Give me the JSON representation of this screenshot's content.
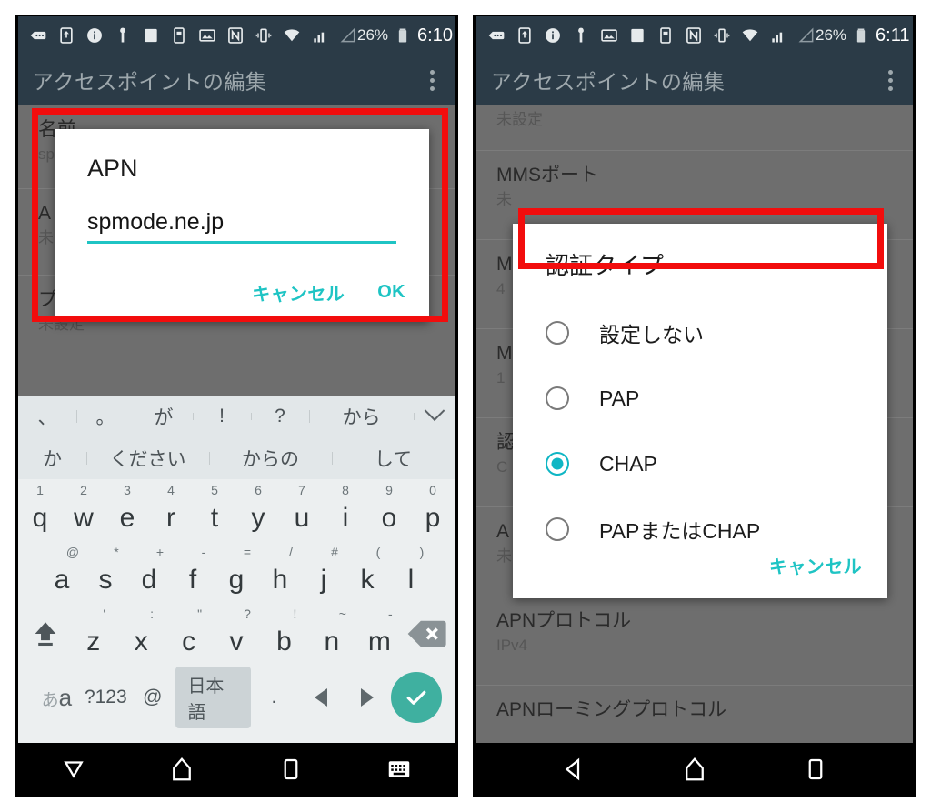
{
  "left_phone": {
    "status_bar": {
      "icons": [
        "sms-icon",
        "sd-card-icon",
        "info-icon",
        "usb-key-icon",
        "screenshot-icon",
        "image-icon",
        "sim-icon",
        "nfc-icon",
        "vibrate-icon",
        "wifi-icon",
        "signal-icon",
        "signal-alt-icon"
      ],
      "battery_percent": "26%",
      "battery_icon": "battery-icon",
      "clock": "6:10"
    },
    "app_bar": {
      "title": "アクセスポイントの編集",
      "overflow_icon": "more-vert-icon"
    },
    "list": [
      {
        "title": "名前",
        "subtitle": "sp"
      },
      {
        "title": "A",
        "subtitle": "未"
      },
      {
        "title": "プロキシ",
        "subtitle": "未設定"
      }
    ],
    "dialog": {
      "title": "APN",
      "input_value": "spmode.ne.jp",
      "cancel_label": "キャンセル",
      "ok_label": "OK",
      "accent_color": "#1fc4c4"
    },
    "keyboard": {
      "suggestions_row1": [
        "、",
        "。",
        "が",
        "!",
        "?",
        "から"
      ],
      "expand_icon": "chevron-down-icon",
      "suggestions_row2": [
        "か",
        "ください",
        "からの",
        "して"
      ],
      "row1": [
        {
          "main": "q",
          "sup": "1"
        },
        {
          "main": "w",
          "sup": "2"
        },
        {
          "main": "e",
          "sup": "3"
        },
        {
          "main": "r",
          "sup": "4"
        },
        {
          "main": "t",
          "sup": "5"
        },
        {
          "main": "y",
          "sup": "6"
        },
        {
          "main": "u",
          "sup": "7"
        },
        {
          "main": "i",
          "sup": "8"
        },
        {
          "main": "o",
          "sup": "9"
        },
        {
          "main": "p",
          "sup": "0"
        }
      ],
      "row2": [
        {
          "main": "a",
          "sup": "@"
        },
        {
          "main": "s",
          "sup": "*"
        },
        {
          "main": "d",
          "sup": "+"
        },
        {
          "main": "f",
          "sup": "-"
        },
        {
          "main": "g",
          "sup": "="
        },
        {
          "main": "h",
          "sup": "/"
        },
        {
          "main": "j",
          "sup": "#"
        },
        {
          "main": "k",
          "sup": "("
        },
        {
          "main": "l",
          "sup": ")"
        }
      ],
      "row3": [
        {
          "main": "z",
          "sup": "'"
        },
        {
          "main": "x",
          "sup": ":"
        },
        {
          "main": "c",
          "sup": "\""
        },
        {
          "main": "v",
          "sup": "?"
        },
        {
          "main": "b",
          "sup": "!"
        },
        {
          "main": "n",
          "sup": "~"
        },
        {
          "main": "m",
          "sup": "-"
        }
      ],
      "shift_icon": "shift-icon",
      "backspace_icon": "backspace-icon",
      "mode_label_kana": "あ",
      "mode_label_alpha": "a",
      "symbols_label": "?123",
      "at_label": "@",
      "language_label": "日本語",
      "period_label": ".",
      "arrow_left_icon": "arrow-left-icon",
      "arrow_right_icon": "arrow-right-icon",
      "enter_icon": "check-icon",
      "enter_color": "#3fb0a0"
    },
    "nav_bar": {
      "buttons": [
        "hide-keyboard-icon",
        "home-icon",
        "recents-icon",
        "keyboard-switch-icon"
      ]
    },
    "annotation": {
      "color": "#f20d0d",
      "target": "apn-dialog"
    }
  },
  "right_phone": {
    "status_bar": {
      "icons": [
        "sms-icon",
        "sd-card-icon",
        "info-icon",
        "usb-key-icon",
        "image-icon",
        "screenshot-icon",
        "sim-icon",
        "nfc-icon",
        "vibrate-icon",
        "wifi-icon",
        "signal-icon",
        "signal-alt-icon"
      ],
      "battery_percent": "26%",
      "battery_icon": "battery-icon",
      "clock": "6:11"
    },
    "app_bar": {
      "title": "アクセスポイントの編集",
      "overflow_icon": "more-vert-icon"
    },
    "list": [
      {
        "title": "",
        "subtitle": "未設定"
      },
      {
        "title": "MMSポート",
        "subtitle": "未"
      },
      {
        "title": "M",
        "subtitle": "4"
      },
      {
        "title": "M",
        "subtitle": "1"
      },
      {
        "title": "認",
        "subtitle": "C"
      },
      {
        "title": "A",
        "subtitle": "未設定"
      },
      {
        "title": "APNプロトコル",
        "subtitle": "IPv4"
      },
      {
        "title": "APNローミングプロトコル",
        "subtitle": ""
      }
    ],
    "dialog": {
      "title": "認証タイプ",
      "options": [
        {
          "label": "設定しない",
          "selected": false
        },
        {
          "label": "PAP",
          "selected": false
        },
        {
          "label": "CHAP",
          "selected": true
        },
        {
          "label": "PAPまたはCHAP",
          "selected": false
        }
      ],
      "cancel_label": "キャンセル",
      "accent_color": "#0fb6c4"
    },
    "nav_bar": {
      "buttons": [
        "back-icon",
        "home-icon",
        "recents-icon"
      ]
    },
    "annotation": {
      "color": "#f20d0d",
      "target": "chap-option"
    }
  }
}
